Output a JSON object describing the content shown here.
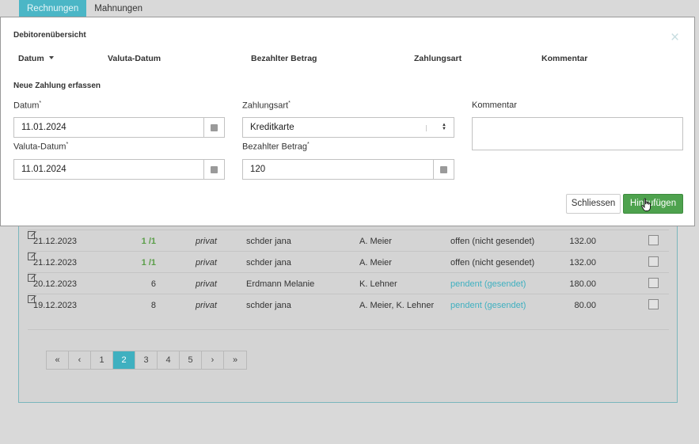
{
  "tabs": [
    {
      "label": "Rechnungen",
      "active": true
    },
    {
      "label": "Mahnungen",
      "active": false
    }
  ],
  "modal": {
    "title": "Debitorenübersicht",
    "columns": [
      "Datum",
      "Valuta-Datum",
      "Bezahlter Betrag",
      "Zahlungsart",
      "Kommentar"
    ],
    "section_title": "Neue Zahlung erfassen",
    "fields": {
      "datum": {
        "label": "Datum",
        "value": "11.01.2024",
        "required": "*"
      },
      "valuta": {
        "label": "Valuta-Datum",
        "value": "11.01.2024",
        "required": "*"
      },
      "zahlungsart": {
        "label": "Zahlungsart",
        "value": "Kreditkarte",
        "required": "*"
      },
      "betrag": {
        "label": "Bezahlter Betrag",
        "value": "120",
        "required": "*"
      },
      "kommentar": {
        "label": "Kommentar",
        "value": ""
      }
    },
    "buttons": {
      "close": "Schliessen",
      "add": "Hinzufügen"
    },
    "close_icon": "×"
  },
  "table": {
    "rows": [
      {
        "date": "21.12.2023",
        "num": "1 /1",
        "num_green": true,
        "type": "privat",
        "name": "schder jana",
        "resp": "A. Meier",
        "status": "offen (nicht gesendet)",
        "status_color": "#333333",
        "amount": "132.00"
      },
      {
        "date": "21.12.2023",
        "num": "1 /1",
        "num_green": true,
        "type": "privat",
        "name": "schder jana",
        "resp": "A. Meier",
        "status": "offen (nicht gesendet)",
        "status_color": "#333333",
        "amount": "132.00"
      },
      {
        "date": "20.12.2023",
        "num": "6",
        "num_green": false,
        "type": "privat",
        "name": "Erdmann Melanie",
        "resp": "K. Lehner",
        "status": "pendent (gesendet)",
        "status_color": "#3fb0c0",
        "amount": "180.00"
      },
      {
        "date": "19.12.2023",
        "num": "8",
        "num_green": false,
        "type": "privat",
        "name": "schder jana",
        "resp": "A. Meier, K. Lehner",
        "status": "pendent (gesendet)",
        "status_color": "#3fb0c0",
        "amount": "80.00"
      }
    ]
  },
  "pagination": {
    "items": [
      "«",
      "‹",
      "1",
      "2",
      "3",
      "4",
      "5",
      "›",
      "»"
    ],
    "active": "2"
  },
  "colors": {
    "accent": "#4bb6c6",
    "primary_button": "#4ea24e",
    "link_status": "#3fb0c0"
  }
}
